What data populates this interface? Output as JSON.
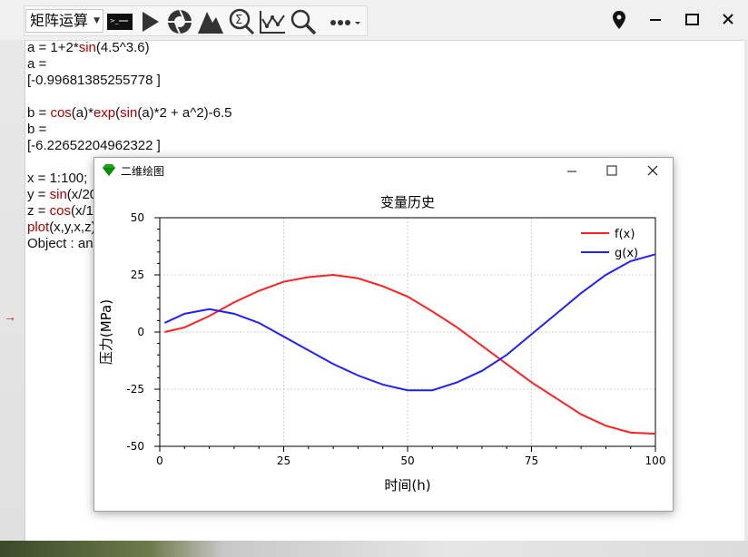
{
  "toolbar": {
    "mode_select": "矩阵运算",
    "icons": [
      "terminal-icon",
      "run-icon",
      "aperture-icon",
      "mountain-icon",
      "sigma-search-icon",
      "plot-icon",
      "zoom-icon",
      "more-icon"
    ],
    "right_icons": [
      "location-pin-icon",
      "minimize-icon",
      "maximize-icon",
      "close-icon"
    ]
  },
  "console": {
    "lines": [
      {
        "parts": [
          {
            "t": "a = 1+2*"
          },
          {
            "t": "sin",
            "fn": true
          },
          {
            "t": "(4.5^3.6)"
          }
        ]
      },
      {
        "parts": [
          {
            "t": "a ="
          }
        ]
      },
      {
        "parts": [
          {
            "t": "[-0.99681385255778 ]"
          }
        ]
      },
      {
        "parts": [
          {
            "t": ""
          }
        ]
      },
      {
        "parts": [
          {
            "t": "b = "
          },
          {
            "t": "cos",
            "fn": true
          },
          {
            "t": "(a)*"
          },
          {
            "t": "exp",
            "fn": true
          },
          {
            "t": "("
          },
          {
            "t": "sin",
            "fn": true
          },
          {
            "t": "(a)*2 + a^2)-6.5"
          }
        ]
      },
      {
        "parts": [
          {
            "t": "b ="
          }
        ]
      },
      {
        "parts": [
          {
            "t": "[-6.22652204962322 ]"
          }
        ]
      },
      {
        "parts": [
          {
            "t": ""
          }
        ]
      },
      {
        "parts": [
          {
            "t": "x = 1:100;"
          }
        ]
      },
      {
        "parts": [
          {
            "t": "y = "
          },
          {
            "t": "sin",
            "fn": true
          },
          {
            "t": "(x/20"
          }
        ]
      },
      {
        "parts": [
          {
            "t": "z = "
          },
          {
            "t": "cos",
            "fn": true
          },
          {
            "t": "(x/1"
          }
        ]
      },
      {
        "parts": [
          {
            "t": "plot",
            "fn": true
          },
          {
            "t": "(x,y,x,z)"
          }
        ]
      },
      {
        "parts": [
          {
            "t": "Object : an"
          }
        ]
      }
    ]
  },
  "plot_window": {
    "title": "二维绘图",
    "buttons": [
      "minimize-icon",
      "maximize-icon",
      "close-icon"
    ]
  },
  "chart_data": {
    "type": "line",
    "title": "变量历史",
    "xlabel": "时间(h)",
    "ylabel": "压力(MPa)",
    "xlim": [
      0,
      100
    ],
    "ylim": [
      -50,
      50
    ],
    "xticks": [
      0,
      25,
      50,
      75,
      100
    ],
    "yticks": [
      -50,
      -25,
      0,
      25,
      50
    ],
    "grid": true,
    "legend_position": "top-right",
    "series": [
      {
        "name": "f(x)",
        "color": "#ff2020",
        "x": [
          1,
          5,
          10,
          15,
          20,
          25,
          30,
          35,
          40,
          45,
          50,
          55,
          60,
          65,
          70,
          75,
          80,
          85,
          90,
          95,
          100
        ],
        "y": [
          0,
          2,
          7,
          13,
          18,
          22,
          24,
          25,
          23.5,
          20,
          15.5,
          9,
          2,
          -6,
          -14,
          -22,
          -29,
          -36,
          -41,
          -44,
          -44.5
        ]
      },
      {
        "name": "g(x)",
        "color": "#2020ff",
        "x": [
          1,
          5,
          10,
          15,
          20,
          25,
          30,
          35,
          40,
          45,
          50,
          55,
          60,
          65,
          70,
          75,
          80,
          85,
          90,
          95,
          100
        ],
        "y": [
          4,
          8,
          10,
          8,
          4,
          -2,
          -8,
          -14,
          -19,
          -23,
          -25.5,
          -25.5,
          -22,
          -17,
          -10,
          -1,
          8,
          17,
          25,
          31,
          34
        ]
      }
    ]
  }
}
